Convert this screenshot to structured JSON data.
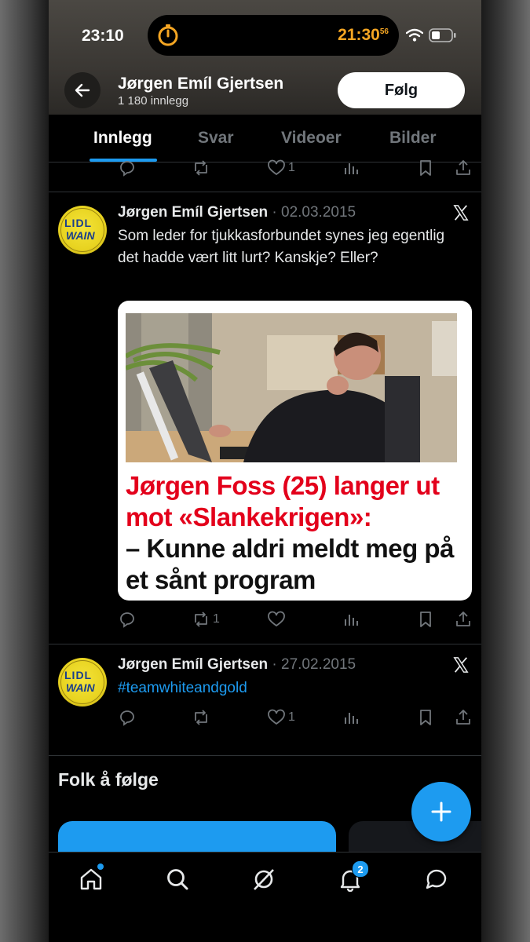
{
  "status_bar": {
    "time": "23:10",
    "timer_time": "21:30",
    "timer_seconds": "56"
  },
  "header": {
    "profile_name": "Jørgen Emíl Gjertsen",
    "post_count": "1 180 innlegg",
    "follow_label": "Følg"
  },
  "tabs": [
    {
      "label": "Innlegg",
      "active": true
    },
    {
      "label": "Svar",
      "active": false
    },
    {
      "label": "Videoer",
      "active": false
    },
    {
      "label": "Bilder",
      "active": false
    }
  ],
  "previous_tweet_actions": {
    "likes": "1"
  },
  "tweets": [
    {
      "author": "Jørgen Emíl Gjertsen",
      "date": "· 02.03.2015",
      "text": "Som leder for tjukkasforbundet synes jeg egentlig det hadde vært litt lurt? Kanskje? Eller?",
      "card": {
        "headline_red": "Jørgen Foss (25) langer ut mot «Slankekrigen»:",
        "headline_black": "– Kunne aldri meldt meg på et sånt program"
      },
      "retweets": "1",
      "likes": ""
    },
    {
      "author": "Jørgen Emíl Gjertsen",
      "date": "· 27.02.2015",
      "text": "#teamwhiteandgold",
      "retweets": "",
      "likes": "1"
    }
  ],
  "avatar_logo": {
    "top": "LIDL",
    "bottom": "WAIN"
  },
  "who_to_follow": {
    "title": "Folk å følge"
  },
  "bottom_nav": {
    "notifications_badge": "2"
  },
  "colors": {
    "accent": "#1d9bf0",
    "background": "#000000",
    "muted": "#71767b",
    "headline_red": "#e3001b"
  }
}
